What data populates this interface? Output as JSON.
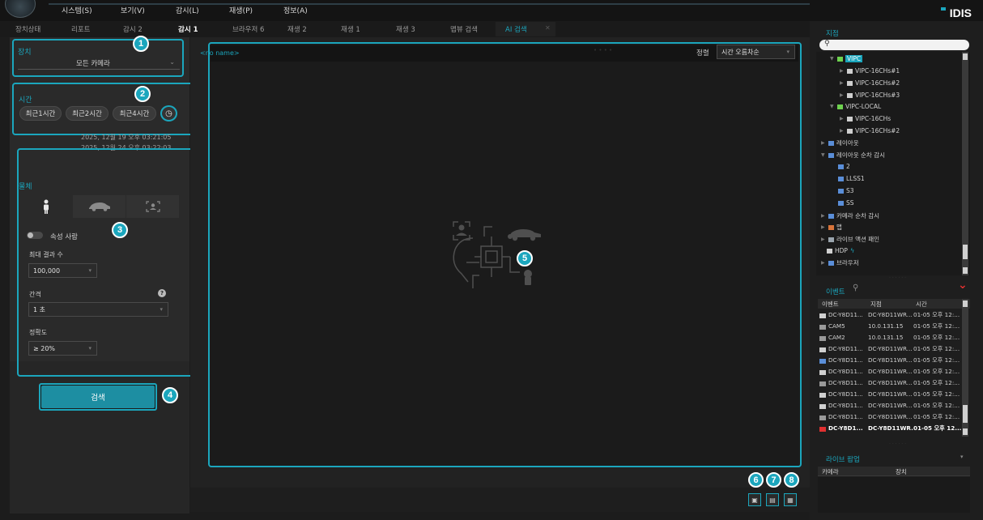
{
  "menu": {
    "items": [
      "시스템(S)",
      "보기(V)",
      "감시(L)",
      "재생(P)",
      "정보(A)"
    ],
    "brand": "IDIS"
  },
  "tabs": [
    {
      "label": "장치상태",
      "state": "normal"
    },
    {
      "label": "리포트",
      "state": "normal"
    },
    {
      "label": "감시 2",
      "state": "normal"
    },
    {
      "label": "감시 1",
      "state": "active"
    },
    {
      "label": "브라우저 6",
      "state": "normal"
    },
    {
      "label": "재생 2",
      "state": "normal"
    },
    {
      "label": "재생 1",
      "state": "normal"
    },
    {
      "label": "재생 3",
      "state": "normal"
    },
    {
      "label": "맵뷰 검색",
      "state": "normal"
    },
    {
      "label": "AI 검색",
      "state": "ai"
    }
  ],
  "left": {
    "device": {
      "label": "장치",
      "value": "모든 카메라"
    },
    "time": {
      "label": "시간",
      "chips": [
        "최근1시간",
        "최근2시간",
        "최근4시간"
      ],
      "range_start": "2025, 12월 19 오후 03:21:05",
      "range_end": "2025, 12월 24 오후 03:22:03"
    },
    "object": {
      "label": "물체",
      "attribute_label": "속성 사람",
      "max_results_label": "최대 결과 수",
      "max_results_value": "100,000",
      "interval_label": "간격",
      "interval_value": "1 초",
      "accuracy_label": "정확도",
      "accuracy_value": "≥ 20%"
    },
    "search_button": "검색"
  },
  "player": {
    "name": "<no name>",
    "sort_label": "정렬",
    "sort_value": "시간 오름차순"
  },
  "badges": [
    "1",
    "2",
    "3",
    "4",
    "5",
    "6",
    "7",
    "8"
  ],
  "site_panel": {
    "title": "지점",
    "tree": [
      {
        "label": "VIPC",
        "selected": true
      },
      {
        "label": "VIPC-16CHs#1"
      },
      {
        "label": "VIPC-16CHs#2"
      },
      {
        "label": "VIPC-16CHs#3"
      },
      {
        "label": "VIPC-LOCAL"
      },
      {
        "label": "VIPC-16CHs"
      },
      {
        "label": "VIPC-16CHs#2"
      },
      {
        "label": "레이아웃"
      },
      {
        "label": "레이아웃 순차 감시"
      },
      {
        "label": "2"
      },
      {
        "label": "LLSS1"
      },
      {
        "label": "S3"
      },
      {
        "label": "SS"
      },
      {
        "label": "카메라 순차 감시"
      },
      {
        "label": "맵"
      },
      {
        "label": "라이브 액션 패인"
      },
      {
        "label": "HDP"
      },
      {
        "label": "브라우저"
      }
    ]
  },
  "event_panel": {
    "title": "이벤트",
    "columns": [
      "이벤트",
      "지점",
      "시간"
    ],
    "rows": [
      [
        "DC-Y8D11...",
        "DC-Y8D11WR...",
        "01-05 오후 12:..."
      ],
      [
        "CAM5",
        "10.0.131.15",
        "01-05 오후 12:..."
      ],
      [
        "CAM2",
        "10.0.131.15",
        "01-05 오후 12:..."
      ],
      [
        "DC-Y8D11...",
        "DC-Y8D11WR...",
        "01-05 오후 12:..."
      ],
      [
        "DC-Y8D11...",
        "DC-Y8D11WR...",
        "01-05 오후 12:..."
      ],
      [
        "DC-Y8D11...",
        "DC-Y8D11WR...",
        "01-05 오후 12:..."
      ],
      [
        "DC-Y8D11...",
        "DC-Y8D11WR...",
        "01-05 오후 12:..."
      ],
      [
        "DC-Y8D11...",
        "DC-Y8D11WR...",
        "01-05 오후 12:..."
      ],
      [
        "DC-Y8D11...",
        "DC-Y8D11WR...",
        "01-05 오후 12:..."
      ],
      [
        "DC-Y8D11...",
        "DC-Y8D11WR...",
        "01-05 오후 12:..."
      ],
      [
        "DC-Y8D11...",
        "DC-Y8D11WR...",
        "01-05 오후 12:..."
      ],
      [
        "DC-Y8D1...",
        "DC-Y8D11WR...",
        "01-05 오후 12..."
      ]
    ]
  },
  "live_popup": {
    "title": "라이브 팝업",
    "columns": [
      "카메라",
      "장치"
    ]
  },
  "colors": {
    "accent": "#1ba6bd",
    "background": "#1c1c1c"
  }
}
